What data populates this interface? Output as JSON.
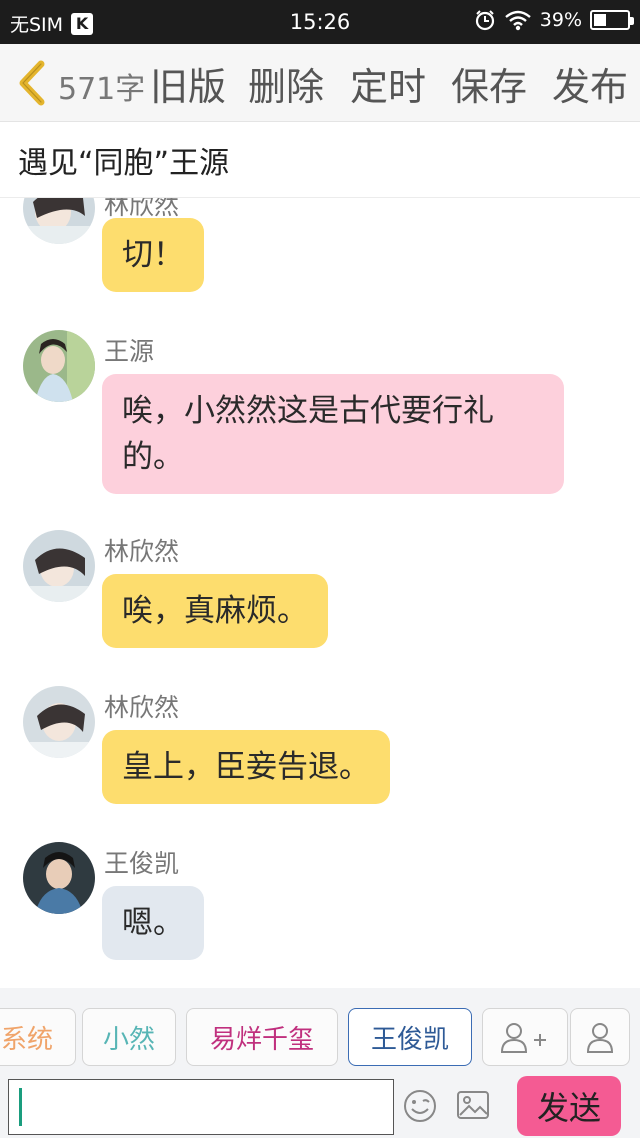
{
  "status_bar": {
    "carrier": "无SIM",
    "badge": "K",
    "time": "15:26",
    "battery": "39%",
    "battery_level": 0.39
  },
  "toolbar": {
    "word_count": "571字",
    "actions": [
      "旧版",
      "删除",
      "定时",
      "保存",
      "发布"
    ]
  },
  "title": "遇见“同胞”王源",
  "messages": [
    {
      "speaker": "林欣然",
      "text": "切！",
      "color": "#fddd6e",
      "avatar": "linxinran-avatar"
    },
    {
      "speaker": "王源",
      "text": "唉，小然然这是古代要行礼的。",
      "color": "#fdd0dc",
      "avatar": "wangyuan-avatar"
    },
    {
      "speaker": "林欣然",
      "text": "唉，真麻烦。",
      "color": "#fddd6e",
      "avatar": "linxinran-avatar"
    },
    {
      "speaker": "林欣然",
      "text": "皇上，臣妾告退。",
      "color": "#fddd6e",
      "avatar": "linxinran-avatar"
    },
    {
      "speaker": "王俊凯",
      "text": "嗯。",
      "color": "#e2e8ef",
      "avatar": "wangjunkai-avatar"
    }
  ],
  "roles": [
    {
      "label": "系统",
      "color": "#f0a46a",
      "selected": false
    },
    {
      "label": "小然",
      "color": "#57b5b5",
      "selected": false
    },
    {
      "label": "易烊千玺",
      "color": "#c0307e",
      "selected": false
    },
    {
      "label": "王俊凯",
      "color": "#2e5a96",
      "selected": true
    }
  ],
  "role_icons": [
    "add-role-icon",
    "role-manage-icon"
  ],
  "input": {
    "value": "",
    "send_label": "发送",
    "send_color": "#f45b93"
  }
}
